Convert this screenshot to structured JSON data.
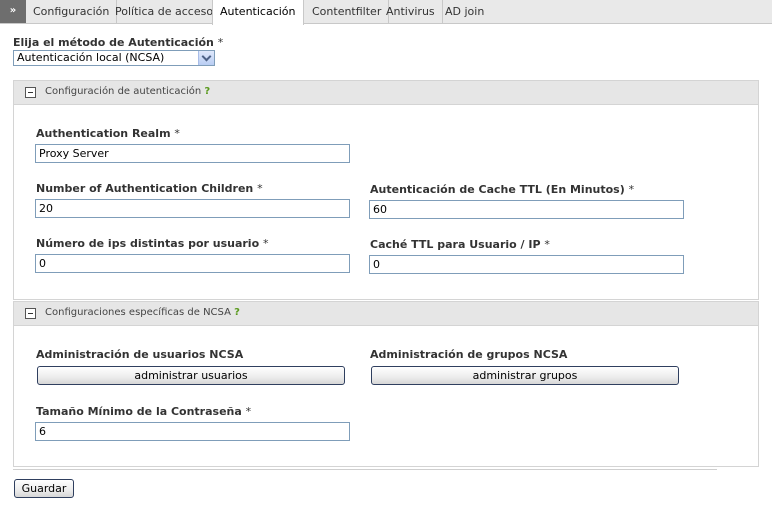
{
  "tabs": {
    "arrow": "»",
    "items": [
      {
        "label": "Configuración"
      },
      {
        "label": "Política de acceso"
      },
      {
        "label": "Autenticación"
      },
      {
        "label": "Contentfilter"
      },
      {
        "label": "Antivirus"
      },
      {
        "label": "AD join"
      }
    ],
    "active": "Autenticación"
  },
  "auth_method": {
    "label": "Elija el método de Autenticación",
    "required_mark": "*",
    "selected": "Autenticación local (NCSA)"
  },
  "auth_config": {
    "title": "Configuración de autenticación",
    "help": "?",
    "realm": {
      "label": "Authentication Realm",
      "required_mark": "*",
      "value": "Proxy Server"
    },
    "children": {
      "label": "Number of Authentication Children",
      "required_mark": "*",
      "value": "20"
    },
    "cache_ttl": {
      "label": "Autenticación de Cache TTL (En Minutos)",
      "required_mark": "*",
      "value": "60"
    },
    "ips_per_user": {
      "label": "Número de ips distintas por usuario",
      "required_mark": "*",
      "value": "0"
    },
    "user_ip_ttl": {
      "label": "Caché TTL para Usuario / IP",
      "required_mark": "*",
      "value": "0"
    }
  },
  "ncsa_config": {
    "title": "Configuraciones específicas de NCSA",
    "help": "?",
    "users_admin": {
      "label": "Administración de usuarios NCSA",
      "button": "administrar usuarios"
    },
    "groups_admin": {
      "label": "Administración de grupos NCSA",
      "button": "administrar grupos"
    },
    "min_password": {
      "label": "Tamaño Mínimo de la Contraseña",
      "required_mark": "*",
      "value": "6"
    }
  },
  "save_button": "Guardar",
  "colors": {
    "tab_bar": "#e9e9e9",
    "arrow_tab": "#6e6e6e",
    "panel_header": "#e6e6e6",
    "help_icon": "#5a9a1e",
    "input_border": "#7f9db9"
  }
}
